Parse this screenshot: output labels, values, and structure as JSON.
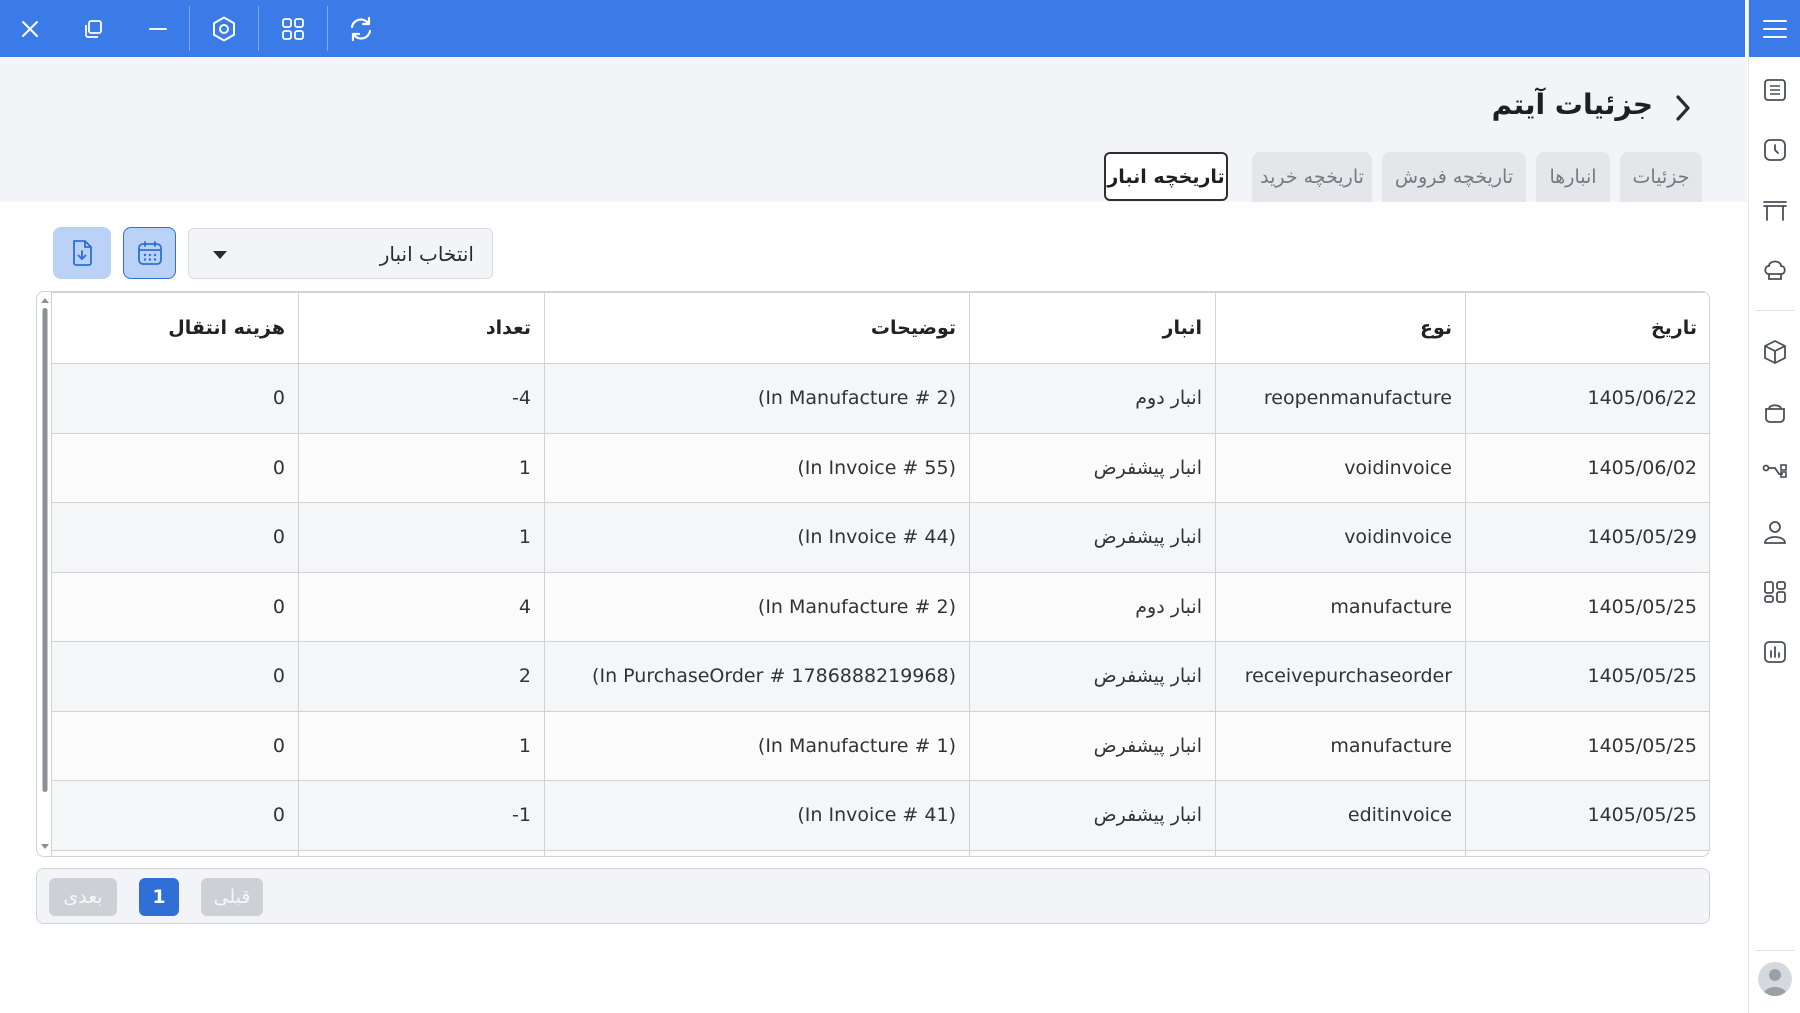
{
  "titlebar": {
    "icons": [
      "close-icon",
      "restore-icon",
      "minimize-icon",
      "settings-icon",
      "apps-grid-icon",
      "refresh-icon"
    ],
    "accent_color": "#3b7be8"
  },
  "sidebar": {
    "icons": [
      "menu-icon",
      "list-icon",
      "clock-icon",
      "table-icon",
      "chef-hat-icon",
      "box-icon",
      "pot-icon",
      "workflow-icon",
      "user-icon",
      "dashboard-icon",
      "report-icon",
      "avatar-icon"
    ]
  },
  "header": {
    "title": "جزئیات آیتم"
  },
  "tabs": [
    {
      "label": "جزئیات",
      "active": false
    },
    {
      "label": "انبارها",
      "active": false
    },
    {
      "label": "تاریخچه فروش",
      "active": false
    },
    {
      "label": "تاریخچه خرید",
      "active": false
    },
    {
      "label": "تاریخچه انبار",
      "active": true
    }
  ],
  "filters": {
    "warehouse_select": "انتخاب انبار"
  },
  "table": {
    "columns": [
      "تاریخ",
      "نوع",
      "انبار",
      "توضیحات",
      "تعداد",
      "هزینه انتقال"
    ],
    "rows": [
      [
        "1405/06/22",
        "reopenmanufacture",
        "انبار دوم",
        "(In Manufacture # 2)",
        "4-",
        "0"
      ],
      [
        "1405/06/02",
        "voidinvoice",
        "انبار پیشفرض",
        "(In Invoice # 55)",
        "1",
        "0"
      ],
      [
        "1405/05/29",
        "voidinvoice",
        "انبار پیشفرض",
        "(In Invoice # 44)",
        "1",
        "0"
      ],
      [
        "1405/05/25",
        "manufacture",
        "انبار دوم",
        "(In Manufacture # 2)",
        "4",
        "0"
      ],
      [
        "1405/05/25",
        "receivepurchaseorder",
        "انبار پیشفرض",
        "(In PurchaseOrder # 1786888219968)",
        "2",
        "0"
      ],
      [
        "1405/05/25",
        "manufacture",
        "انبار پیشفرض",
        "(In Manufacture # 1)",
        "1",
        "0"
      ],
      [
        "1405/05/25",
        "editinvoice",
        "انبار پیشفرض",
        "(In Invoice # 41)",
        "1-",
        "0"
      ]
    ]
  },
  "pagination": {
    "prev_label": "قبلی",
    "current_page": "1",
    "next_label": "بعدی"
  }
}
